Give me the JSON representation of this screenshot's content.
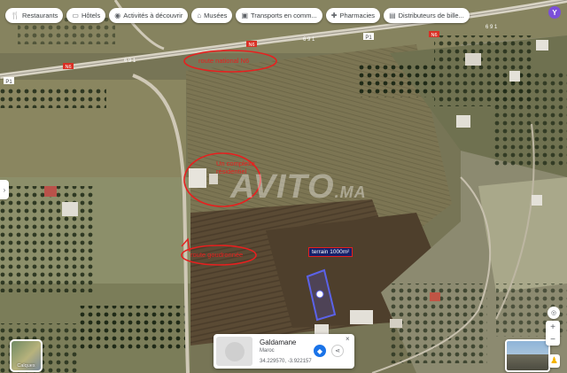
{
  "chips": [
    {
      "icon": "utensils",
      "label": "Restaurants"
    },
    {
      "icon": "bed",
      "label": "Hôtels"
    },
    {
      "icon": "camera",
      "label": "Activités à découvrir"
    },
    {
      "icon": "museum",
      "label": "Musées"
    },
    {
      "icon": "bus",
      "label": "Transports en comm..."
    },
    {
      "icon": "pill",
      "label": "Pharmacies"
    },
    {
      "icon": "atm",
      "label": "Distributeurs de bille..."
    }
  ],
  "profile_initial": "Y",
  "road_labels": {
    "p1_left": "P1",
    "n6_left": "N6",
    "n6_mid": "N6",
    "p1_right": "P1",
    "n6_right": "N6",
    "km_left": "6 9 1",
    "km_mid": "6 9 1",
    "km_right": "6 9 1"
  },
  "annotations": {
    "route_nationale": "route national N6",
    "un_complexe": "Un complexe résidentiel",
    "route_goudronnee": "route goudronnée",
    "terrain_area": "terrain 1000m²"
  },
  "watermark": {
    "main": "AVITO",
    "suffix": ".MA"
  },
  "layers_label": "Calques",
  "place_card": {
    "title": "Galdamane",
    "subtitle": "Maroc",
    "coords": "34.229570, -3.922157"
  },
  "colors": {
    "annotation_red": "#e6201f",
    "price_box_bg": "#16206a",
    "accent_blue": "#1a73e8"
  }
}
